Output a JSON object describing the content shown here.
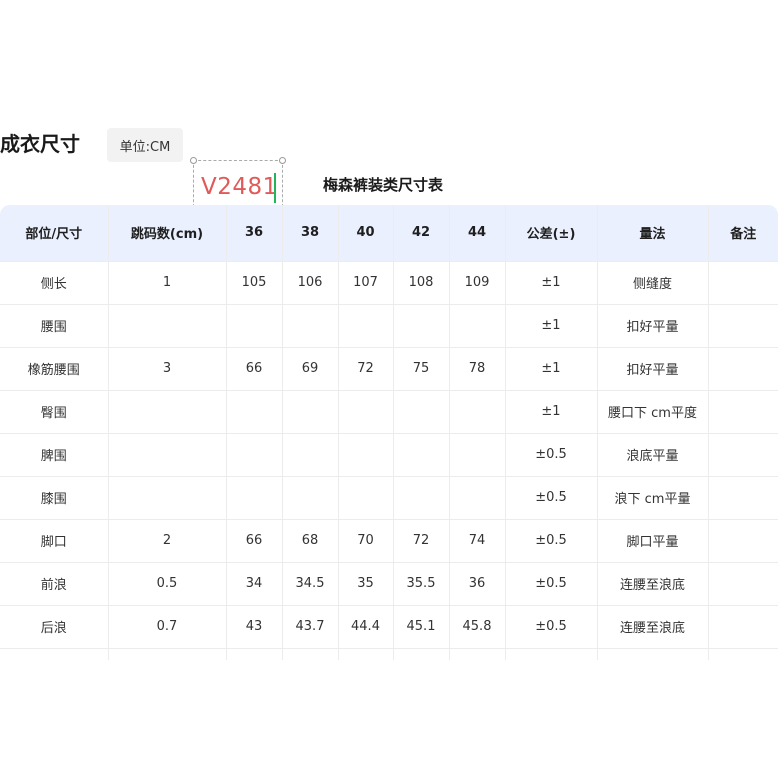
{
  "page": {
    "title": "成衣尺寸",
    "unit_label": "单位:CM",
    "code": "V2481",
    "table_title": "梅森裤装类尺寸表"
  },
  "colors": {
    "header_bg": "#eaf0fd",
    "code_text": "#e05a5a",
    "cursor": "#22b55a",
    "badge_bg": "#f2f2f2"
  },
  "table": {
    "headers": [
      "部位/尺寸",
      "跳码数(cm)",
      "36",
      "38",
      "40",
      "42",
      "44",
      "公差(±)",
      "量法",
      "备注"
    ],
    "rows": [
      [
        "侧长",
        "1",
        "105",
        "106",
        "107",
        "108",
        "109",
        "±1",
        "侧缝度",
        ""
      ],
      [
        "腰围",
        "",
        "",
        "",
        "",
        "",
        "",
        "±1",
        "扣好平量",
        ""
      ],
      [
        "橡筋腰围",
        "3",
        "66",
        "69",
        "72",
        "75",
        "78",
        "±1",
        "扣好平量",
        ""
      ],
      [
        "臀围",
        "",
        "",
        "",
        "",
        "",
        "",
        "±1",
        "腰口下 cm平度",
        ""
      ],
      [
        "脾围",
        "",
        "",
        "",
        "",
        "",
        "",
        "±0.5",
        "浪底平量",
        ""
      ],
      [
        "膝围",
        "",
        "",
        "",
        "",
        "",
        "",
        "±0.5",
        "浪下 cm平量",
        ""
      ],
      [
        "脚口",
        "2",
        "66",
        "68",
        "70",
        "72",
        "74",
        "±0.5",
        "脚口平量",
        ""
      ],
      [
        "前浪",
        "0.5",
        "34",
        "34.5",
        "35",
        "35.5",
        "36",
        "±0.5",
        "连腰至浪底",
        ""
      ],
      [
        "后浪",
        "0.7",
        "43",
        "43.7",
        "44.4",
        "45.1",
        "45.8",
        "±0.5",
        "连腰至浪底",
        ""
      ],
      [
        "",
        "",
        "",
        "",
        "",
        "",
        "",
        "",
        "",
        ""
      ]
    ]
  }
}
